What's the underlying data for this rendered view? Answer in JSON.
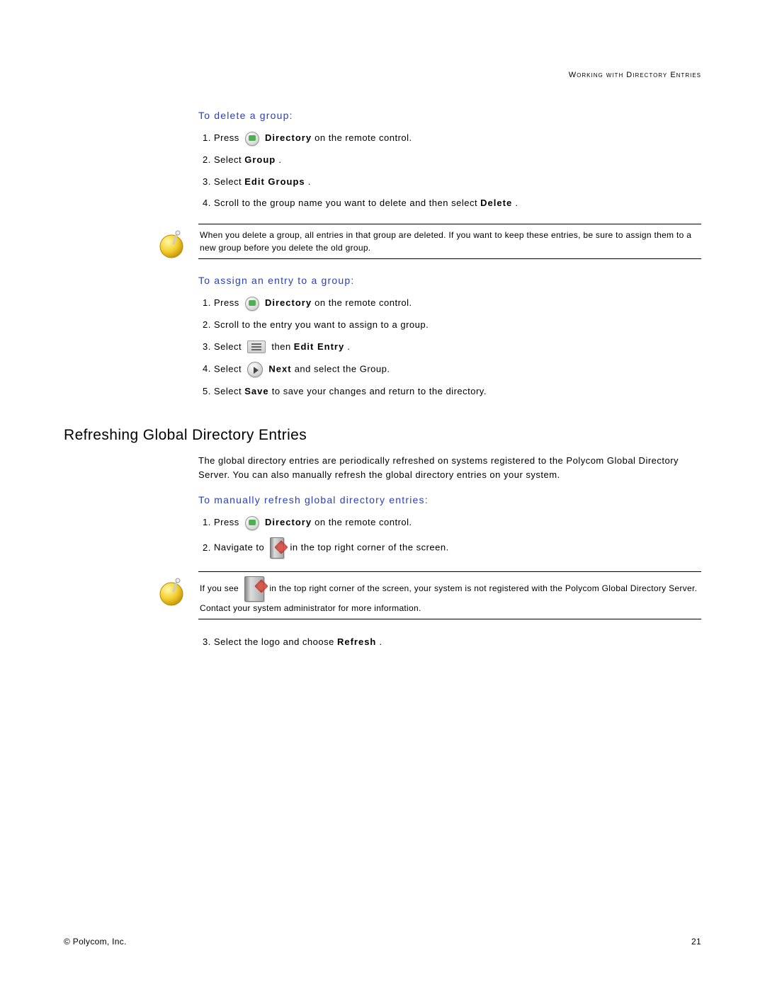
{
  "header": "Working with Directory Entries",
  "section1": {
    "title": "To delete a group:",
    "steps": {
      "s1a": "Press ",
      "s1b": " Directory",
      "s1c": " on the remote control.",
      "s2a": "Select ",
      "s2b": "Group",
      "s2c": ".",
      "s3a": "Select ",
      "s3b": "Edit Groups",
      "s3c": ".",
      "s4a": "Scroll to the group name you want to delete and then select ",
      "s4b": "Delete",
      "s4c": "."
    }
  },
  "note1": "When you delete a group, all entries in that group are deleted. If you want to keep these entries, be sure to assign them to a new group before you delete the old group.",
  "section2": {
    "title": "To assign an entry to a group:",
    "steps": {
      "s1a": "Press ",
      "s1b": " Directory",
      "s1c": " on the remote control.",
      "s2": "Scroll to the entry you want to assign to a group.",
      "s3a": "Select ",
      "s3b": " then ",
      "s3c": "Edit Entry",
      "s3d": ".",
      "s4a": "Select ",
      "s4b": " Next",
      "s4c": " and select the Group.",
      "s5a": "Select ",
      "s5b": "Save",
      "s5c": " to save your changes and return to the directory."
    }
  },
  "heading2": "Refreshing Global Directory Entries",
  "intro": "The global directory entries are periodically refreshed on systems registered to the Polycom Global Directory Server. You can also manually refresh the global directory entries on your system.",
  "section3": {
    "title": "To manually refresh global directory entries:",
    "steps": {
      "s1a": "Press ",
      "s1b": " Directory",
      "s1c": " on the remote control.",
      "s2a": "Navigate to ",
      "s2b": " in the top right corner of the screen.",
      "s3a": "Select the logo and choose ",
      "s3b": "Refresh",
      "s3c": "."
    }
  },
  "note2a": "If you see ",
  "note2b": " in the top right corner of the screen, your system is not registered with the Polycom Global Directory Server. Contact your system administrator for more information.",
  "footer": {
    "left": "© Polycom, Inc.",
    "right": "21"
  }
}
